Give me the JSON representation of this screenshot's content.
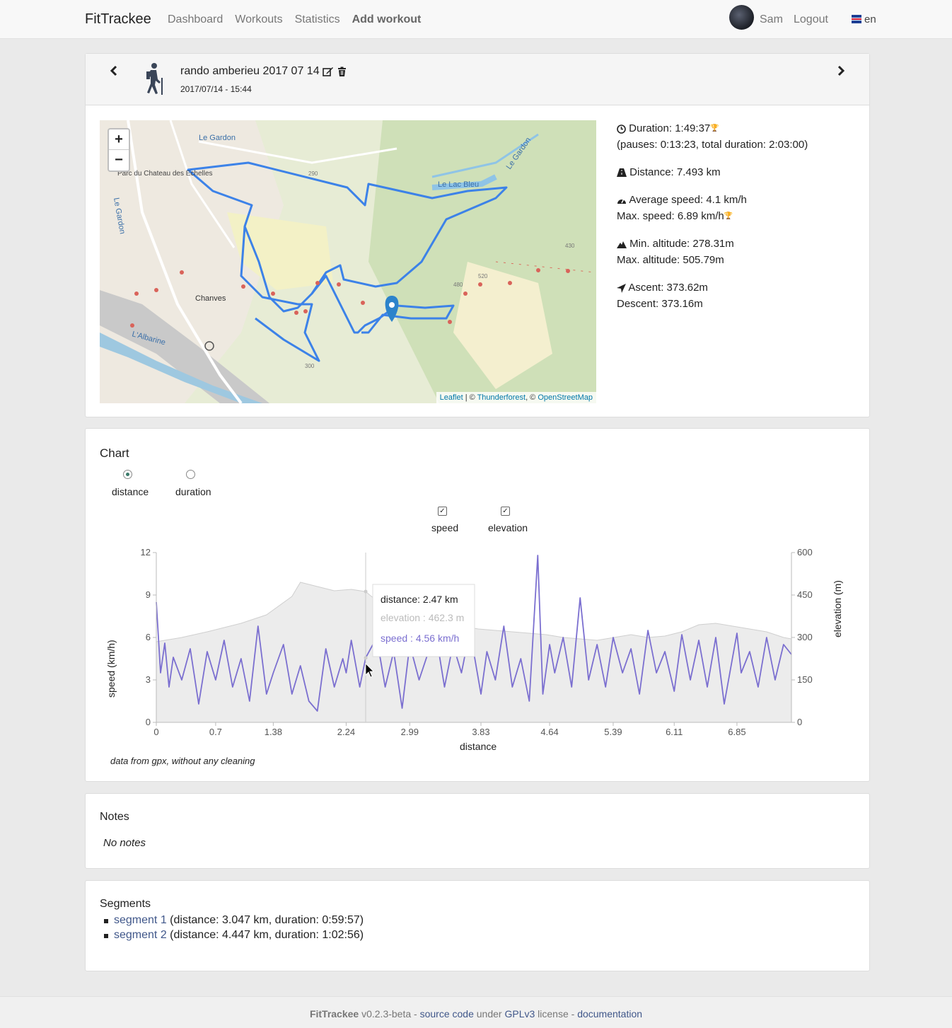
{
  "nav": {
    "brand": "FitTrackee",
    "links": [
      "Dashboard",
      "Workouts",
      "Statistics",
      "Add workout"
    ],
    "user": "Sam",
    "logout": "Logout",
    "lang": "en"
  },
  "workout": {
    "title": "rando amberieu 2017 07 14",
    "date": "2017/07/14 - 15:44",
    "map_attribution": {
      "leaflet": "Leaflet",
      "sep1": " | © ",
      "thunder": "Thunderforest",
      "sep2": ", © ",
      "osm": "OpenStreetMap"
    },
    "map_labels": [
      "Le Gardon",
      "Parc du Chateau des Echelles",
      "Le Gardon",
      "Le Lac Bleu",
      "Le Gardon",
      "Chanves",
      "L'Albarine",
      "290",
      "430",
      "480",
      "520",
      "300"
    ],
    "stats": {
      "duration": "Duration: 1:49:37",
      "pauses": "(pauses: 0:13:23, total duration: 2:03:00)",
      "distance": "Distance: 7.493 km",
      "avg_speed": "Average speed: 4.1 km/h",
      "max_speed": "Max. speed: 6.89 km/h",
      "min_alt": "Min. altitude: 278.31m",
      "max_alt": "Max. altitude: 505.79m",
      "ascent": "Ascent: 373.62m",
      "descent": "Descent: 373.16m"
    }
  },
  "chart_section": {
    "title": "Chart",
    "radio_distance": "distance",
    "radio_duration": "duration",
    "check_speed": "speed",
    "check_elevation": "elevation",
    "note": "data from gpx, without any cleaning",
    "tooltip": {
      "distance": "distance: 2.47 km",
      "elevation": "elevation : 462.3 m",
      "speed": "speed : 4.56 km/h"
    }
  },
  "chart_data": {
    "type": "line",
    "xlabel": "distance",
    "ylabel": "speed (km/h)",
    "y2label": "elevation (m)",
    "x_ticks": [
      "0",
      "0.7",
      "1.38",
      "2.24",
      "2.99",
      "3.83",
      "4.64",
      "5.39",
      "6.11",
      "6.85"
    ],
    "y_ticks": [
      "0",
      "3",
      "6",
      "9",
      "12"
    ],
    "y2_ticks": [
      "0",
      "150",
      "300",
      "450",
      "600"
    ],
    "xlim": [
      0,
      7.493
    ],
    "ylim": [
      0,
      12
    ],
    "y2lim": [
      0,
      600
    ],
    "series": [
      {
        "name": "elevation",
        "color": "#e8e8e8",
        "x": [
          0,
          0.1,
          0.3,
          0.6,
          1.0,
          1.3,
          1.6,
          1.7,
          1.9,
          2.1,
          2.3,
          2.47,
          2.6,
          2.8,
          3.0,
          3.2,
          3.4,
          3.6,
          3.8,
          4.0,
          4.2,
          4.4,
          4.6,
          4.8,
          5.0,
          5.2,
          5.4,
          5.6,
          5.8,
          6.0,
          6.2,
          6.4,
          6.6,
          6.8,
          7.0,
          7.2,
          7.4,
          7.493
        ],
        "values": [
          285,
          290,
          300,
          320,
          350,
          380,
          445,
          495,
          480,
          465,
          470,
          462,
          430,
          400,
          380,
          360,
          350,
          340,
          330,
          325,
          320,
          315,
          310,
          300,
          295,
          290,
          300,
          310,
          300,
          305,
          320,
          345,
          350,
          340,
          330,
          320,
          300,
          295
        ]
      },
      {
        "name": "speed",
        "color": "#7b6fd0",
        "x": [
          0,
          0.05,
          0.1,
          0.15,
          0.2,
          0.3,
          0.4,
          0.5,
          0.6,
          0.7,
          0.8,
          0.9,
          1.0,
          1.1,
          1.2,
          1.3,
          1.38,
          1.5,
          1.6,
          1.7,
          1.8,
          1.9,
          2.0,
          2.1,
          2.2,
          2.24,
          2.3,
          2.4,
          2.47,
          2.6,
          2.7,
          2.8,
          2.9,
          2.99,
          3.1,
          3.2,
          3.3,
          3.4,
          3.5,
          3.6,
          3.7,
          3.83,
          3.9,
          4.0,
          4.1,
          4.2,
          4.3,
          4.4,
          4.5,
          4.56,
          4.64,
          4.7,
          4.8,
          4.9,
          5.0,
          5.1,
          5.2,
          5.3,
          5.39,
          5.5,
          5.6,
          5.7,
          5.8,
          5.9,
          6.0,
          6.11,
          6.2,
          6.3,
          6.4,
          6.5,
          6.6,
          6.7,
          6.85,
          6.9,
          7.0,
          7.1,
          7.2,
          7.3,
          7.4,
          7.493
        ],
        "values": [
          8.5,
          3.5,
          5.6,
          2.5,
          4.6,
          3.0,
          5.2,
          1.3,
          5.0,
          3.0,
          5.8,
          2.5,
          4.5,
          1.5,
          6.8,
          2.0,
          3.5,
          5.5,
          2.0,
          4.0,
          1.5,
          0.8,
          5.2,
          2.5,
          4.5,
          3.5,
          5.8,
          2.5,
          4.56,
          6.0,
          2.5,
          5.0,
          1.0,
          5.5,
          3.0,
          4.8,
          6.2,
          2.5,
          5.5,
          3.5,
          6.5,
          2.0,
          5.0,
          3.0,
          6.8,
          2.5,
          4.5,
          1.5,
          11.8,
          2.0,
          5.5,
          3.5,
          6.0,
          2.5,
          8.8,
          3.0,
          5.5,
          2.5,
          6.0,
          3.5,
          5.2,
          2.0,
          6.5,
          3.5,
          5.0,
          2.2,
          6.2,
          3.0,
          5.8,
          2.5,
          6.0,
          1.3,
          6.3,
          3.5,
          5.0,
          2.5,
          6.0,
          3.0,
          5.5,
          4.8
        ]
      }
    ],
    "grid": false,
    "legend": "none"
  },
  "notes": {
    "title": "Notes",
    "text": "No notes"
  },
  "segments": {
    "title": "Segments",
    "items": [
      {
        "link": "segment 1",
        "info": " (distance: 3.047 km, duration: 0:59:57)"
      },
      {
        "link": "segment 2",
        "info": " (distance: 4.447 km, duration: 1:02:56)"
      }
    ]
  },
  "footer": {
    "brand": "FitTrackee",
    "version": " v0.2.3-beta - ",
    "source": "source code",
    "under": " under ",
    "license": "GPLv3",
    "lic": " license - ",
    "doc": "documentation"
  }
}
